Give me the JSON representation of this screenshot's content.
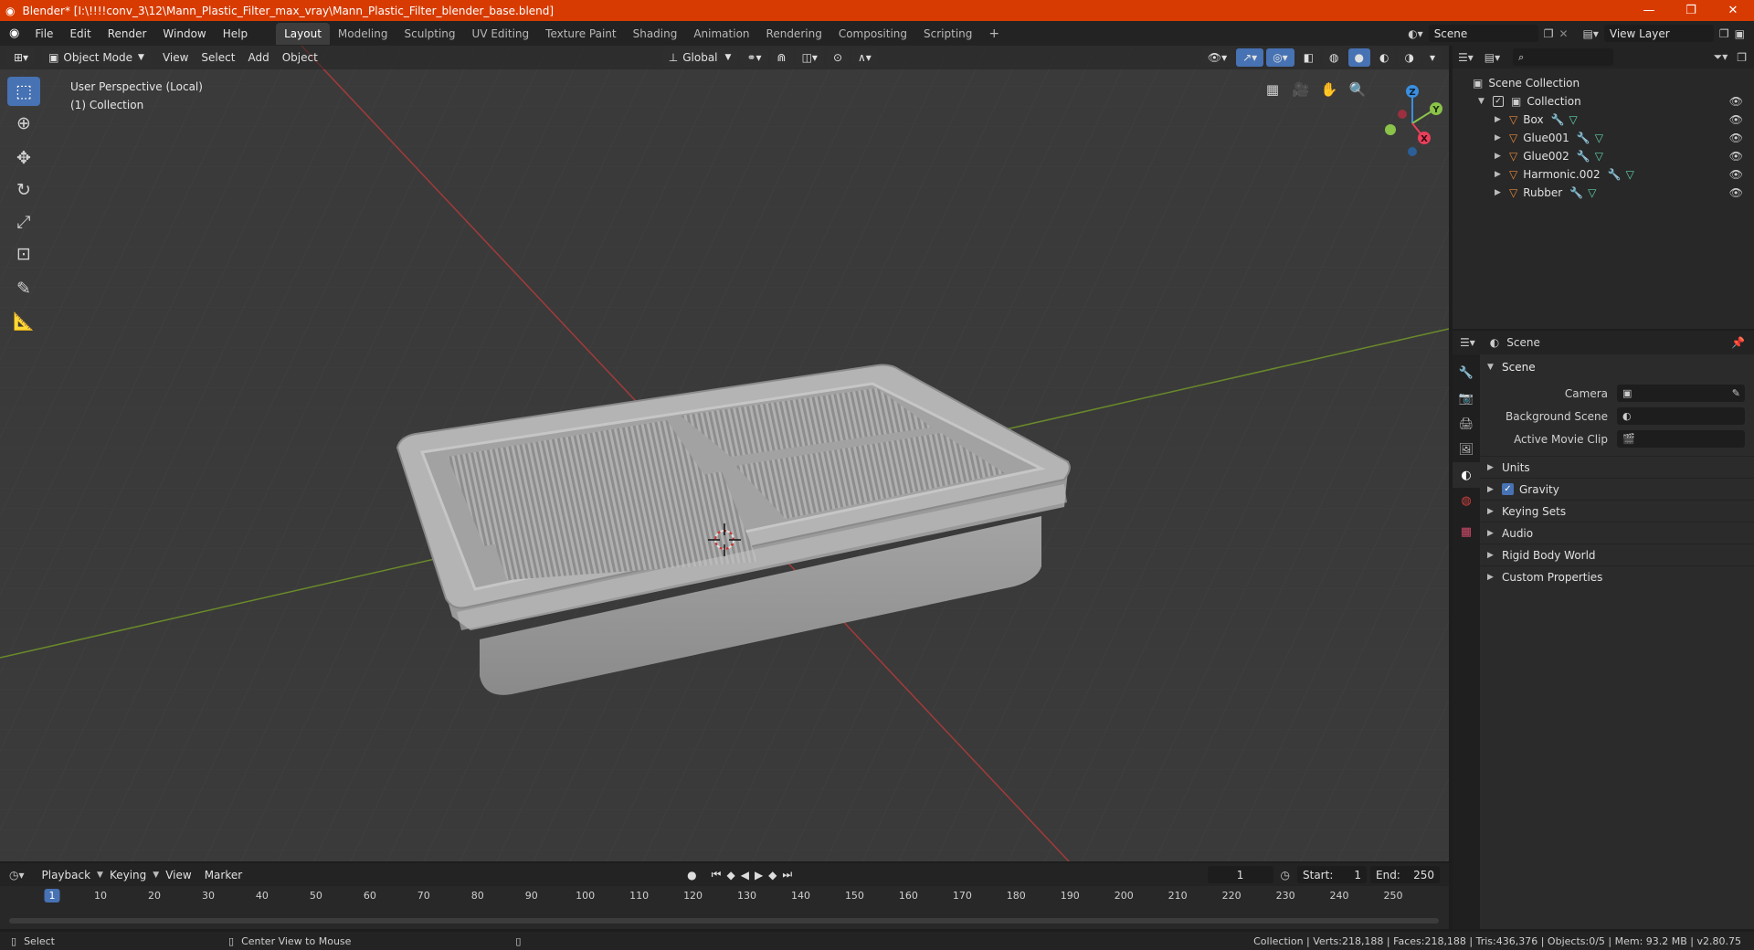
{
  "window": {
    "title": "Blender* [I:\\!!!!conv_3\\12\\Mann_Plastic_Filter_max_vray\\Mann_Plastic_Filter_blender_base.blend]",
    "minimize": "—",
    "maximize": "❐",
    "close": "✕"
  },
  "menubar": {
    "items": [
      "File",
      "Edit",
      "Render",
      "Window",
      "Help"
    ],
    "workspaces": [
      "Layout",
      "Modeling",
      "Sculpting",
      "UV Editing",
      "Texture Paint",
      "Shading",
      "Animation",
      "Rendering",
      "Compositing",
      "Scripting"
    ],
    "add_workspace": "+",
    "scene": "Scene",
    "view_layer": "View Layer"
  },
  "viewport": {
    "mode": "Object Mode",
    "menus": [
      "View",
      "Select",
      "Add",
      "Object"
    ],
    "transform_orientation": "Global",
    "info_line1": "User Perspective (Local)",
    "info_line2": "(1) Collection",
    "gizmo": {
      "z": "Z",
      "y": "Y",
      "x": "X"
    }
  },
  "outliner": {
    "root": "Scene Collection",
    "collection": "Collection",
    "objects": [
      "Box",
      "Glue001",
      "Glue002",
      "Harmonic.002",
      "Rubber"
    ]
  },
  "properties": {
    "header": "Scene",
    "panel": "Scene",
    "camera_label": "Camera",
    "background_scene_label": "Background Scene",
    "active_movie_clip_label": "Active Movie Clip",
    "subpanels": {
      "units": "Units",
      "gravity": "Gravity",
      "keying_sets": "Keying Sets",
      "audio": "Audio",
      "rigid_body_world": "Rigid Body World",
      "custom_properties": "Custom Properties"
    }
  },
  "timeline": {
    "menus": [
      "Playback",
      "Keying",
      "View",
      "Marker"
    ],
    "current_frame": "1",
    "start_label": "Start:",
    "start_value": "1",
    "end_label": "End:",
    "end_value": "250",
    "ruler_ticks": [
      "1",
      "10",
      "20",
      "30",
      "40",
      "50",
      "60",
      "70",
      "80",
      "90",
      "100",
      "110",
      "120",
      "130",
      "140",
      "150",
      "160",
      "170",
      "180",
      "190",
      "200",
      "210",
      "220",
      "230",
      "240",
      "250"
    ]
  },
  "statusbar": {
    "select": "Select",
    "center_view": "Center View to Mouse",
    "stats": "Collection | Verts:218,188 | Faces:218,188 | Tris:436,376 | Objects:0/5 | Mem: 93.2 MB | v2.80.75"
  },
  "colors": {
    "accent": "#4772b3",
    "titlebar": "#d83b01",
    "mesh_icon": "#e88a3a",
    "axis_x": "#e8405a",
    "axis_y": "#8bc34a",
    "axis_z": "#3a8fe0"
  }
}
